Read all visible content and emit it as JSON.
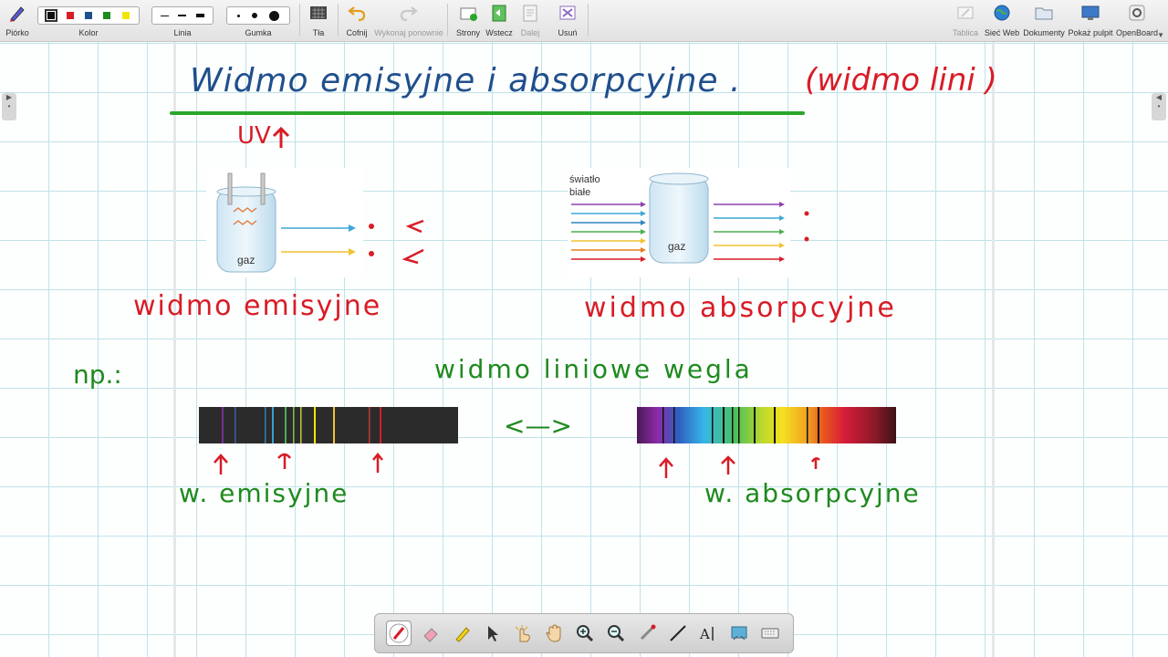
{
  "toolbar": {
    "pen": "Piórko",
    "color": "Kolor",
    "line": "Linia",
    "eraser": "Gumka",
    "background": "Tła",
    "undo": "Cofnij",
    "redo": "Wykonaj ponownie",
    "pages": "Strony",
    "back": "Wstecz",
    "next": "Dalej",
    "delete": "Usuń",
    "board": "Tablica",
    "web": "Sieć Web",
    "documents": "Dokumenty",
    "desktop": "Pokaż pulpit",
    "app": "OpenBoard",
    "colors": [
      "#111111",
      "#d81c26",
      "#1f4f8c",
      "#1e8a1e",
      "#f2e600"
    ]
  },
  "board": {
    "title": "Widmo emisyjne i absorpcyjne .",
    "title_note": "(widmo lini          )",
    "uv_note": "UV",
    "emission_heading": "widmo emisyjne",
    "absorption_heading": "widmo absorpcyjne",
    "example": "np.:",
    "line_spectrum": "widmo liniowe wegla",
    "relation": "<—>",
    "emission_label": "w. emisyjne",
    "absorption_label": "w. absorpcyjne",
    "fig_emission_gas": "gaz",
    "fig_absorption_gas": "gaz",
    "fig_white_light_1": "światło",
    "fig_white_light_2": "białe"
  },
  "colors": {
    "red": "#d81c26",
    "blue": "#1f4f8c",
    "green": "#1e8a1e",
    "grid": "#bfe3ea"
  }
}
